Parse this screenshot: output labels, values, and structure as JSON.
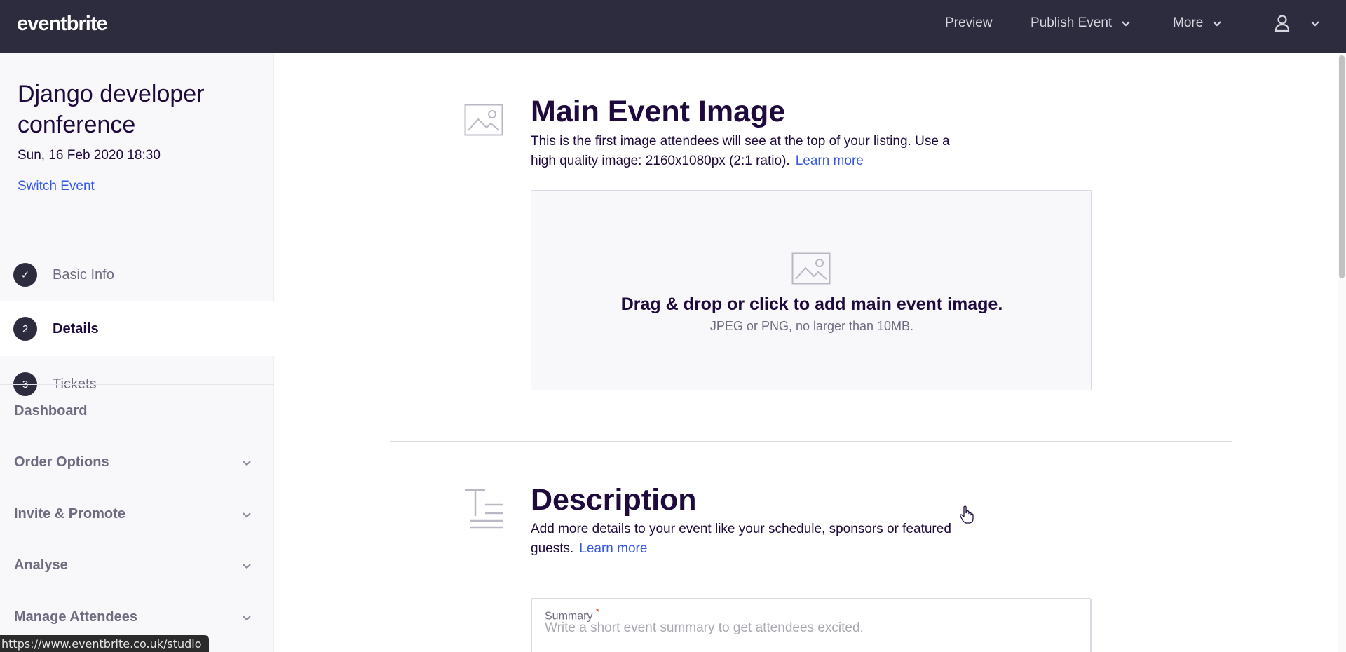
{
  "topbar": {
    "logo": "eventbrite",
    "preview": "Preview",
    "publish": "Publish Event",
    "more": "More",
    "user_icon": "user-icon",
    "bg_color": "#2d2b3e"
  },
  "sidebar": {
    "event_title": "Django developer conference",
    "event_date": "Sun, 16 Feb 2020 18:30",
    "switch_event": "Switch Event",
    "steps": [
      {
        "number": "✓",
        "label": "Basic Info",
        "state": "completed"
      },
      {
        "number": "2",
        "label": "Details",
        "state": "active"
      },
      {
        "number": "3",
        "label": "Tickets",
        "state": "pending"
      }
    ],
    "links": [
      {
        "label": "Dashboard",
        "expandable": false
      },
      {
        "label": "Order Options",
        "expandable": true
      },
      {
        "label": "Invite & Promote",
        "expandable": true
      },
      {
        "label": "Analyse",
        "expandable": true
      },
      {
        "label": "Manage Attendees",
        "expandable": true
      }
    ]
  },
  "main_image": {
    "title": "Main Event Image",
    "description": "This is the first image attendees will see at the top of your listing. Use a high quality image: 2160x1080px (2:1 ratio).",
    "learn_more": "Learn more",
    "dropzone_title": "Drag & drop or click to add main event image.",
    "dropzone_sub": "JPEG or PNG, no larger than 10MB."
  },
  "description_section": {
    "title": "Description",
    "description": "Add more details to your event like your schedule, sponsors or featured guests.",
    "learn_more": "Learn more",
    "summary_label": "Summary",
    "summary_required": "*",
    "summary_placeholder": "Write a short event summary to get attendees excited."
  },
  "status_bar": {
    "url": "https://www.eventbrite.co.uk/studio"
  },
  "colors": {
    "accent": "#3659e3",
    "heading": "#1e0a3c",
    "muted": "#6f6c80"
  }
}
